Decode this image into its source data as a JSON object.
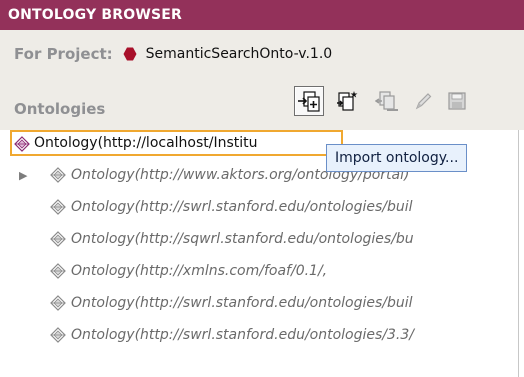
{
  "panel": {
    "title": "ONTOLOGY BROWSER"
  },
  "project": {
    "label": "For Project:",
    "name": "SemanticSearchOnto-v.1.0",
    "icon": "project-hexagon-icon",
    "icon_color": "#a8102a"
  },
  "ontologies": {
    "label": "Ontologies",
    "toolbar": [
      {
        "name": "import-ontology",
        "icon": "import-icon",
        "enabled": true,
        "pressed": true
      },
      {
        "name": "create-ontology",
        "icon": "new-ontology-icon",
        "enabled": true,
        "pressed": false
      },
      {
        "name": "remove-ontology",
        "icon": "remove-icon",
        "enabled": false,
        "pressed": false
      },
      {
        "name": "edit-ontology",
        "icon": "edit-pencil-icon",
        "enabled": false,
        "pressed": false
      },
      {
        "name": "save-ontology",
        "icon": "save-icon",
        "enabled": false,
        "pressed": false
      }
    ]
  },
  "tree": {
    "root": {
      "label": "Ontology(http://localhost/Institu"
    },
    "items": [
      {
        "label": "Ontology(http://www.aktors.org/ontology/portal)",
        "expandable": true
      },
      {
        "label": "Ontology(http://swrl.stanford.edu/ontologies/buil",
        "expandable": false
      },
      {
        "label": "Ontology(http://sqwrl.stanford.edu/ontologies/bu",
        "expandable": false
      },
      {
        "label": "Ontology(http://xmlns.com/foaf/0.1/,",
        "expandable": false
      },
      {
        "label": "Ontology(http://swrl.stanford.edu/ontologies/buil",
        "expandable": false
      },
      {
        "label": "Ontology(http://swrl.stanford.edu/ontologies/3.3/",
        "expandable": false
      }
    ]
  },
  "tooltip": {
    "text": "Import ontology..."
  },
  "colors": {
    "title_bar": "#93315a",
    "panel_bg": "#eeece7",
    "selection_border": "#f0a830",
    "tooltip_bg": "#e8f1fc",
    "tooltip_border": "#6a8fc8"
  }
}
